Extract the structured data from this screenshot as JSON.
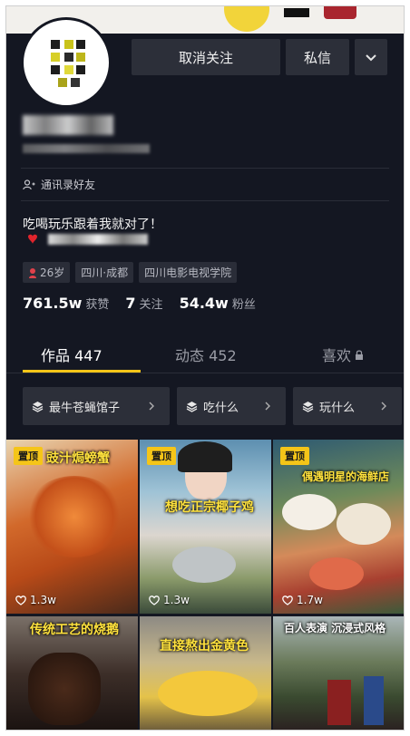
{
  "header": {
    "unfollow_label": "取消关注",
    "message_label": "私信",
    "more_icon": "chevron-down-icon"
  },
  "profile": {
    "contacts_label": "通讯录好友",
    "bio_line1": "吃喝玩乐跟着我就对了！",
    "tags": [
      "26岁",
      "四川·成都",
      "四川电影电视学院"
    ],
    "stats": [
      {
        "num": "761.5w",
        "label": "获赞"
      },
      {
        "num": "7",
        "label": "关注"
      },
      {
        "num": "54.4w",
        "label": "粉丝"
      }
    ]
  },
  "tabs": {
    "works": "作品 447",
    "activity": "动态 452",
    "likes": "喜欢"
  },
  "collections": [
    {
      "label": "最牛苍蝇馆子"
    },
    {
      "label": "吃什么"
    },
    {
      "label": "玩什么"
    }
  ],
  "videos": [
    {
      "pin": "置顶",
      "likes": "1.3w",
      "caption": "豉汁焗螃蟹"
    },
    {
      "pin": "置顶",
      "likes": "1.3w",
      "caption": "想吃正宗椰子鸡"
    },
    {
      "pin": "置顶",
      "likes": "1.7w",
      "caption": "偶遇明星的海鲜店"
    },
    {
      "caption": "传统工艺的烧鹅"
    },
    {
      "caption": "直接熬出金黄色"
    },
    {
      "caption": "百人表演 沉浸式风格"
    }
  ],
  "colors": {
    "background": "#141722",
    "accent": "#f5c518",
    "button": "#2c2f39"
  }
}
